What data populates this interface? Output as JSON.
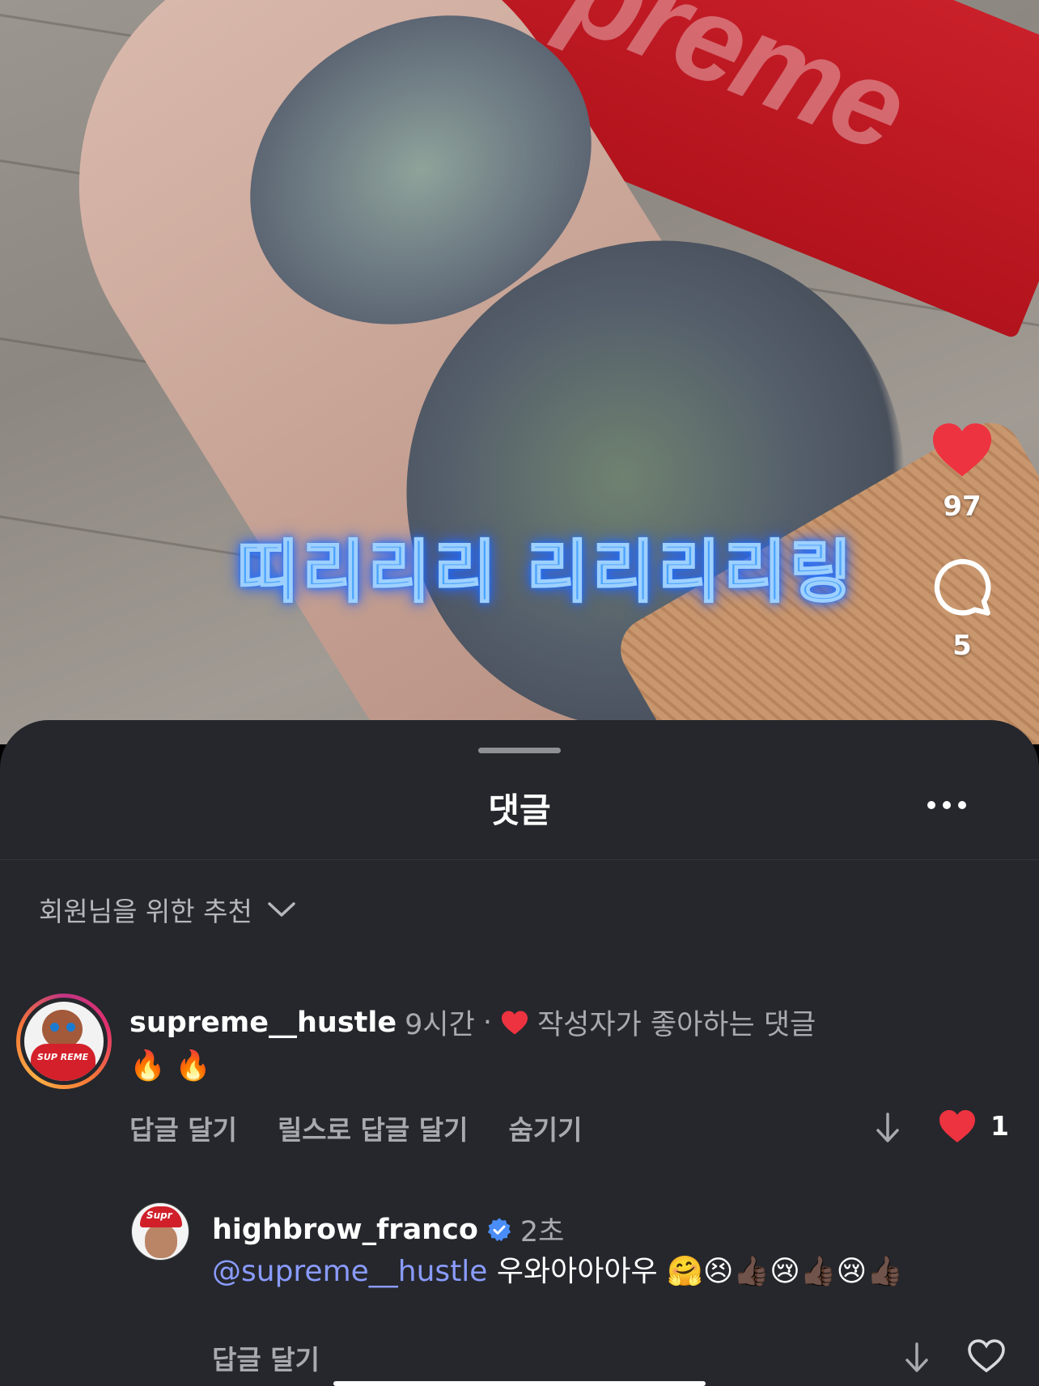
{
  "video": {
    "caption": "띠리리리 리리리리링",
    "box_logo": "preme",
    "likes_count": "97",
    "comments_count": "5"
  },
  "sheet": {
    "title": "댓글",
    "sort_label": "회원님을 위한 추천"
  },
  "comments": [
    {
      "username": "supreme__hustle",
      "time": "9시간",
      "separator": "·",
      "creator_liked_label": "작성자가 좋아하는 댓글",
      "text": "🔥 🔥",
      "avatar_label": "SUP REME",
      "actions": {
        "reply": "답글 달기",
        "reply_reel": "릴스로 답글 달기",
        "hide": "숨기기"
      },
      "like_count": "1"
    },
    {
      "username": "highbrow_franco",
      "time": "2초",
      "mention": "@supreme__hustle",
      "text": " 우와아아아우 🤗😣👍🏿😢👍🏿😢👍🏿",
      "avatar_label": "Supr",
      "actions": {
        "reply": "답글 달기"
      }
    }
  ],
  "colors": {
    "like_red": "#ed3340",
    "mention": "#8a9bff",
    "verified": "#4a8df8",
    "sheet_bg": "#25272c"
  }
}
